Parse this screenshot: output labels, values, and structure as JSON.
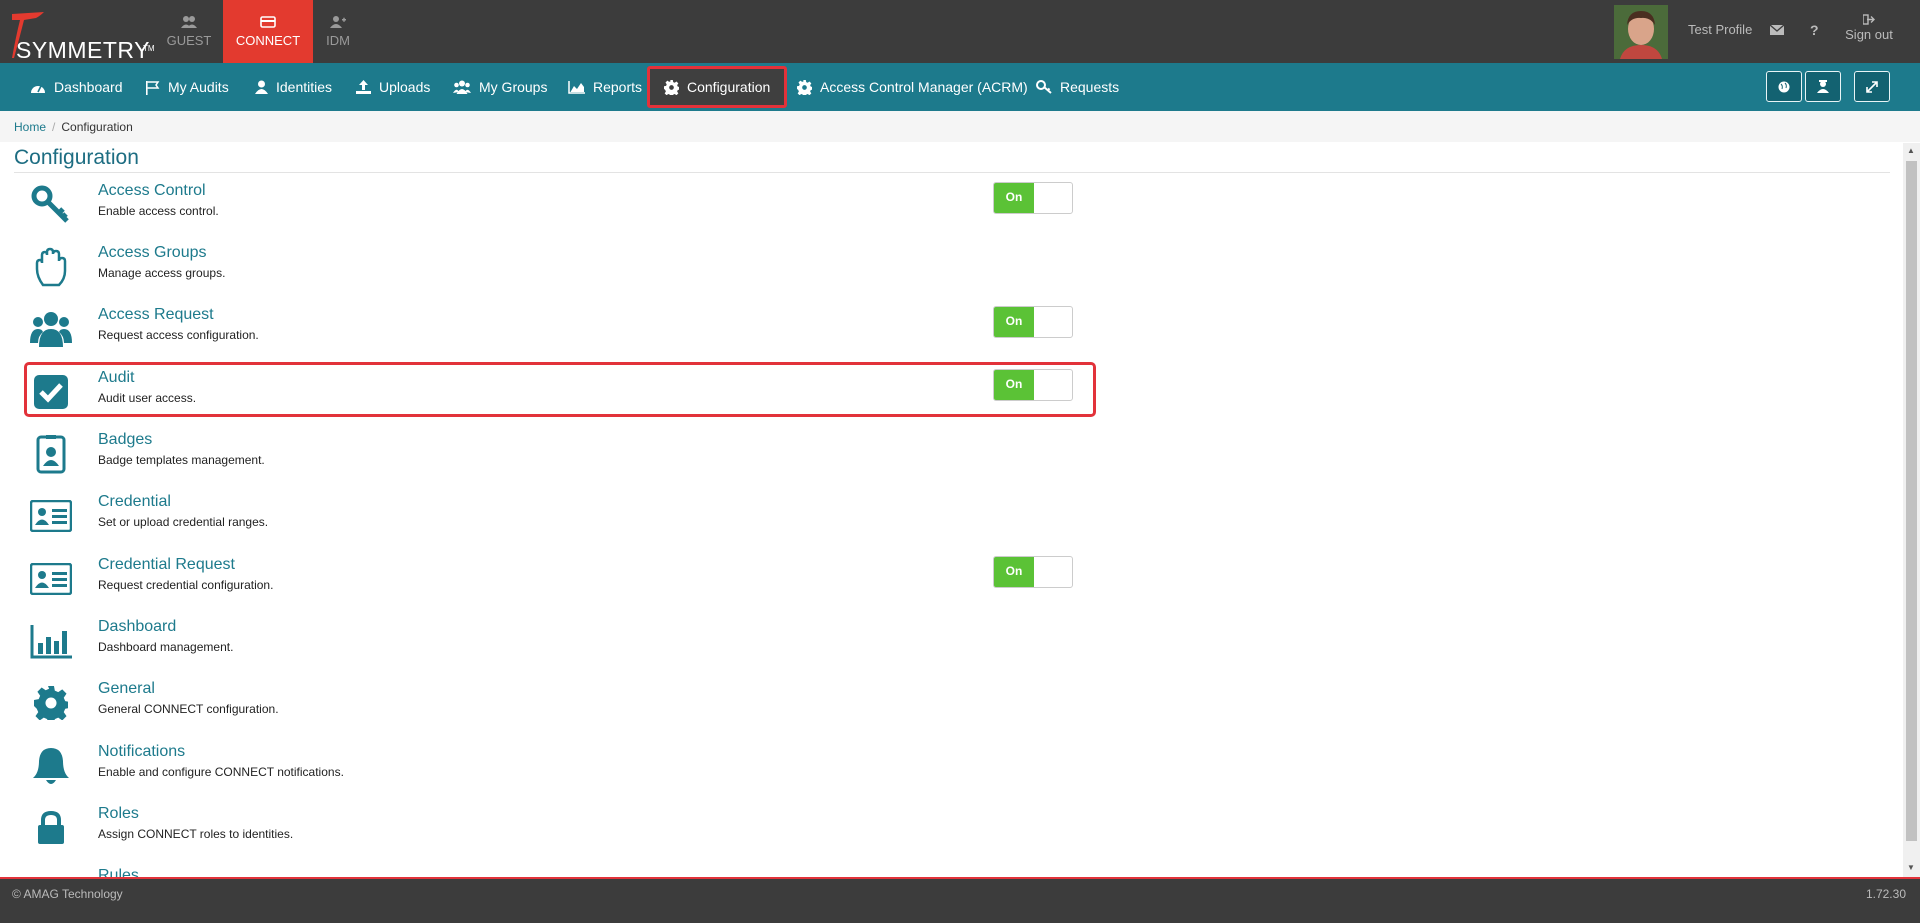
{
  "brand": {
    "logo_text": "SYMMETRY",
    "tm": "TM"
  },
  "apps": [
    {
      "label": "GUEST",
      "icon": "users-icon"
    },
    {
      "label": "CONNECT",
      "icon": "card-icon",
      "active": true
    },
    {
      "label": "IDM",
      "icon": "user-plus-icon"
    }
  ],
  "profile": {
    "name": "Test Profile",
    "signout_label": "Sign out"
  },
  "nav": {
    "items": [
      {
        "label": "Dashboard",
        "icon": "dashboard-icon"
      },
      {
        "label": "My Audits",
        "icon": "flag-icon"
      },
      {
        "label": "Identities",
        "icon": "user-icon"
      },
      {
        "label": "Uploads",
        "icon": "upload-icon"
      },
      {
        "label": "My Groups",
        "icon": "group-icon"
      },
      {
        "label": "Reports",
        "icon": "area-chart-icon"
      },
      {
        "label": "Configuration",
        "icon": "gear-icon",
        "active": true
      },
      {
        "label": "Access Control Manager (ACRM)",
        "icon": "gear-icon"
      },
      {
        "label": "Requests",
        "icon": "key-icon"
      }
    ]
  },
  "breadcrumb": {
    "home": "Home",
    "current": "Configuration"
  },
  "page": {
    "title": "Configuration"
  },
  "config_items": [
    {
      "title": "Access Control",
      "desc": "Enable access control.",
      "icon": "key-icon",
      "toggle": "On"
    },
    {
      "title": "Access Groups",
      "desc": "Manage access groups.",
      "icon": "hand-icon"
    },
    {
      "title": "Access Request",
      "desc": "Request access configuration.",
      "icon": "users-icon",
      "toggle": "On"
    },
    {
      "title": "Audit",
      "desc": "Audit user access.",
      "icon": "check-square-icon",
      "toggle": "On",
      "highlighted": true
    },
    {
      "title": "Badges",
      "desc": "Badge templates management.",
      "icon": "badge-icon"
    },
    {
      "title": "Credential",
      "desc": "Set or upload credential ranges.",
      "icon": "id-card-icon"
    },
    {
      "title": "Credential Request",
      "desc": "Request credential configuration.",
      "icon": "id-card-icon",
      "toggle": "On"
    },
    {
      "title": "Dashboard",
      "desc": "Dashboard management.",
      "icon": "bar-chart-icon"
    },
    {
      "title": "General",
      "desc": "General CONNECT configuration.",
      "icon": "gear-icon"
    },
    {
      "title": "Notifications",
      "desc": "Enable and configure CONNECT notifications.",
      "icon": "bell-icon"
    },
    {
      "title": "Roles",
      "desc": "Assign CONNECT roles to identities.",
      "icon": "lock-icon"
    },
    {
      "title": "Rules",
      "desc": "",
      "icon": "rules-icon"
    }
  ],
  "footer": {
    "copyright": "© AMAG Technology",
    "version": "1.72.30"
  },
  "colors": {
    "topbar": "#3c3c3c",
    "nav": "#1d7a8c",
    "accent_red": "#e33a2f",
    "toggle_on": "#5bc236",
    "link": "#1d7a8c"
  }
}
